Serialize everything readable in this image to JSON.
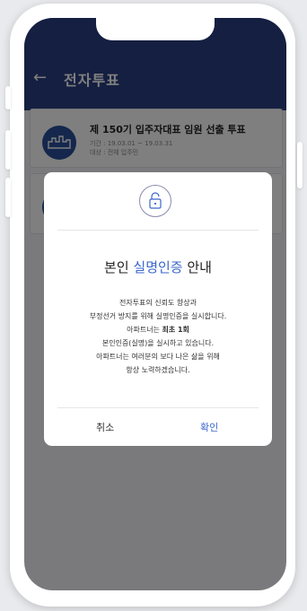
{
  "header": {
    "back_icon": "←",
    "title": "전자투표"
  },
  "cards": [
    {
      "title": "제 150기 입주자대표 임원 선출 투표",
      "period": "기간 : 19.03.01 ~ 19.03.31",
      "target": "대상 : 전체 입주민"
    }
  ],
  "modal": {
    "icon": "lock-icon",
    "title_prefix": "본인 ",
    "title_accent": "실명인증",
    "title_suffix": " 안내",
    "lines": [
      "전자투표의 신뢰도 향상과",
      "부정선거 방지를 위해 실명인증을 실시합니다.",
      "본인인증(실명)을 실시하고 있습니다.",
      "아파트너는 여러분의 보다 나은 삶을 위해",
      "항상 노력하겠습니다."
    ],
    "line3_prefix": "아파트너는 ",
    "line3_bold": "최초 1회",
    "cancel": "취소",
    "confirm": "확인"
  },
  "colors": {
    "header": "#2a3e82",
    "accent": "#3b66cc",
    "overlay": "rgba(0,0,0,0.5)"
  }
}
